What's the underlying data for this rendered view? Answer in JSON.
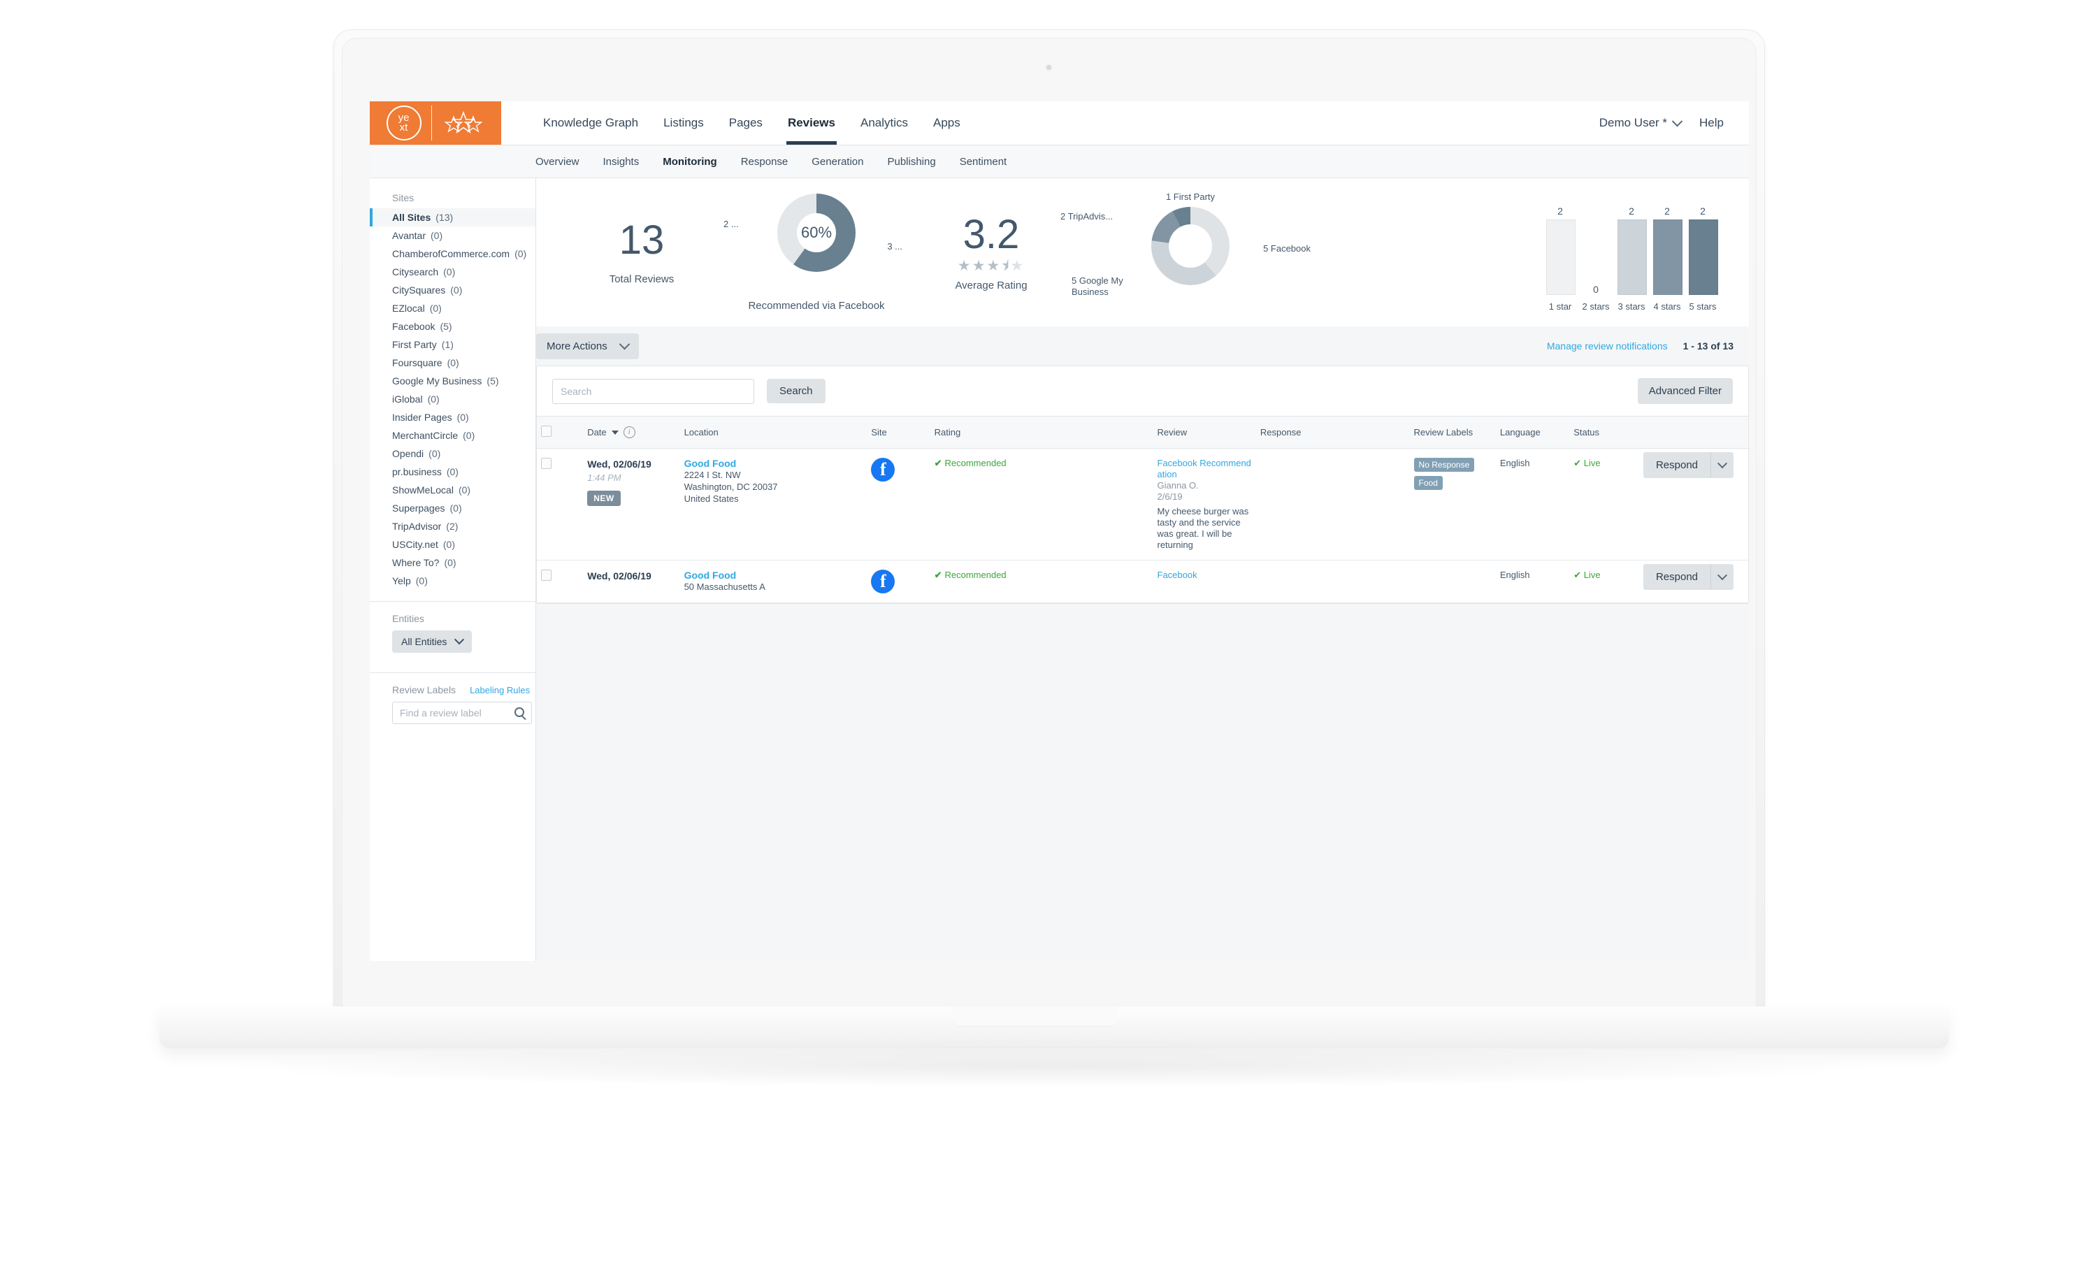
{
  "brand": {
    "logo_top": "ye",
    "logo_bottom": "xt",
    "accent_orange": "#ef7b34",
    "accent_blue": "#2fa8e1",
    "green": "#3aa93a"
  },
  "topnav": {
    "items": [
      {
        "label": "Knowledge Graph",
        "active": false
      },
      {
        "label": "Listings",
        "active": false
      },
      {
        "label": "Pages",
        "active": false
      },
      {
        "label": "Reviews",
        "active": true
      },
      {
        "label": "Analytics",
        "active": false
      },
      {
        "label": "Apps",
        "active": false
      }
    ],
    "user": "Demo User *",
    "help": "Help"
  },
  "subnav": {
    "items": [
      {
        "label": "Overview",
        "active": false
      },
      {
        "label": "Insights",
        "active": false
      },
      {
        "label": "Monitoring",
        "active": true
      },
      {
        "label": "Response",
        "active": false
      },
      {
        "label": "Generation",
        "active": false
      },
      {
        "label": "Publishing",
        "active": false
      },
      {
        "label": "Sentiment",
        "active": false
      }
    ]
  },
  "sidebar": {
    "sites_title": "Sites",
    "sites": [
      {
        "label": "All Sites",
        "count": "(13)",
        "active": true
      },
      {
        "label": "Avantar",
        "count": "(0)",
        "active": false
      },
      {
        "label": "ChamberofCommerce.com",
        "count": "(0)",
        "active": false
      },
      {
        "label": "Citysearch",
        "count": "(0)",
        "active": false
      },
      {
        "label": "CitySquares",
        "count": "(0)",
        "active": false
      },
      {
        "label": "EZlocal",
        "count": "(0)",
        "active": false
      },
      {
        "label": "Facebook",
        "count": "(5)",
        "active": false
      },
      {
        "label": "First Party",
        "count": "(1)",
        "active": false
      },
      {
        "label": "Foursquare",
        "count": "(0)",
        "active": false
      },
      {
        "label": "Google My Business",
        "count": "(5)",
        "active": false
      },
      {
        "label": "iGlobal",
        "count": "(0)",
        "active": false
      },
      {
        "label": "Insider Pages",
        "count": "(0)",
        "active": false
      },
      {
        "label": "MerchantCircle",
        "count": "(0)",
        "active": false
      },
      {
        "label": "Opendi",
        "count": "(0)",
        "active": false
      },
      {
        "label": "pr.business",
        "count": "(0)",
        "active": false
      },
      {
        "label": "ShowMeLocal",
        "count": "(0)",
        "active": false
      },
      {
        "label": "Superpages",
        "count": "(0)",
        "active": false
      },
      {
        "label": "TripAdvisor",
        "count": "(2)",
        "active": false
      },
      {
        "label": "USCity.net",
        "count": "(0)",
        "active": false
      },
      {
        "label": "Where To?",
        "count": "(0)",
        "active": false
      },
      {
        "label": "Yelp",
        "count": "(0)",
        "active": false
      }
    ],
    "entities_title": "Entities",
    "entities_value": "All Entities",
    "review_labels_title": "Review Labels",
    "labeling_rules": "Labeling Rules",
    "label_search_placeholder": "Find a review label"
  },
  "stats": {
    "total_reviews_value": "13",
    "total_reviews_label": "Total Reviews",
    "recommended_percent": "60%",
    "recommended_label": "Recommended via Facebook",
    "recommended_left_label": "2 ...",
    "recommended_right_label": "3 ...",
    "average_rating_value": "3.2",
    "average_rating_label": "Average Rating",
    "average_rating_stars": 3.5,
    "sites_donut": {
      "top_label": "1 First Party",
      "left_label": "2 TripAdvis...",
      "bottom_label": "5 Google My Business",
      "right_label": "5 Facebook"
    }
  },
  "chart_data": [
    {
      "type": "bar",
      "title": "Review count by star rating",
      "categories": [
        "1 star",
        "2 stars",
        "3 stars",
        "4 stars",
        "5 stars"
      ],
      "values": [
        2,
        0,
        2,
        2,
        2
      ],
      "colors": [
        "#eff1f2",
        "#eff1f2",
        "#ccd4da",
        "#8295a4",
        "#68808f"
      ],
      "xlabel": "",
      "ylabel": "",
      "ylim": [
        0,
        2.4
      ],
      "grid": false,
      "legend": "none",
      "data_labels": [
        "2",
        "0",
        "2",
        "2",
        "2"
      ]
    },
    {
      "type": "pie",
      "title": "Recommended via Facebook",
      "center_label": "60%",
      "labels": [
        "3 ...",
        "2 ..."
      ],
      "values": [
        3,
        2
      ],
      "colors": [
        "#68808f",
        "#e3e7ea"
      ]
    },
    {
      "type": "pie",
      "title": "Reviews by site",
      "labels": [
        "5 Facebook",
        "5 Google My Business",
        "2 TripAdvis...",
        "1 First Party"
      ],
      "values": [
        5,
        5,
        2,
        1
      ],
      "colors": [
        "#dfe3e6",
        "#ccd4da",
        "#8295a4",
        "#68808f"
      ]
    }
  ],
  "toolbar": {
    "more_actions": "More Actions",
    "manage_notifications": "Manage review notifications",
    "pagination": "1 - 13 of 13"
  },
  "table_controls": {
    "search_placeholder": "Search",
    "search_button": "Search",
    "advanced_filter": "Advanced Filter"
  },
  "table": {
    "headers": {
      "date": "Date",
      "location": "Location",
      "site": "Site",
      "rating": "Rating",
      "review": "Review",
      "response": "Response",
      "review_labels": "Review Labels",
      "language": "Language",
      "status": "Status"
    },
    "rows": [
      {
        "date_main": "Wed, 02/06/19",
        "date_time": "1:44 PM",
        "badge": "NEW",
        "location_name": "Good Food",
        "location_street": "2224 I St. NW",
        "location_city": "Washington, DC 20037",
        "location_country": "United States",
        "site_icon": "facebook-icon",
        "rating": "Recommended",
        "review_title": "Facebook Recommendation",
        "review_author": "Gianna O.",
        "review_date": "2/6/19",
        "review_body": "My cheese burger was tasty and the service was great. I will be returning",
        "labels": [
          "No Response",
          "Food"
        ],
        "language": "English",
        "status": "Live",
        "respond_label": "Respond"
      },
      {
        "date_main": "Wed, 02/06/19",
        "date_time": "",
        "badge": "",
        "location_name": "Good Food",
        "location_street": "50 Massachusetts A",
        "location_city": "",
        "location_country": "",
        "site_icon": "facebook-icon",
        "rating": "Recommended",
        "review_title": "Facebook",
        "review_author": "",
        "review_date": "",
        "review_body": "",
        "labels": [],
        "language": "English",
        "status": "Live",
        "respond_label": "Respond"
      }
    ]
  }
}
